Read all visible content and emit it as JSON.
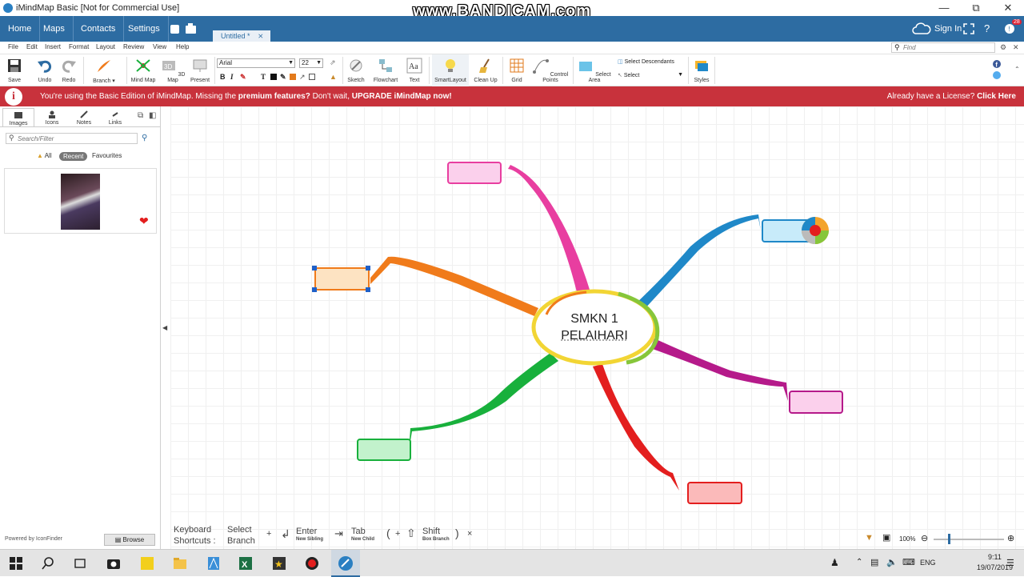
{
  "window": {
    "title": "iMindMap Basic [Not for Commercial Use]",
    "watermark": "www.BANDICAM.com"
  },
  "nav": {
    "home": "Home",
    "maps": "Maps",
    "contacts": "Contacts",
    "settings": "Settings",
    "sign_in": "Sign In",
    "notif_count": "28",
    "doc_tab": "Untitled *"
  },
  "menu": [
    "File",
    "Edit",
    "Insert",
    "Format",
    "Layout",
    "Review",
    "View",
    "Help"
  ],
  "find_placeholder": "Find",
  "ribbon": {
    "save": "Save",
    "undo": "Undo",
    "redo": "Redo",
    "branch": "Branch",
    "mindmap": "Mind Map",
    "map3d": "3D Map",
    "present": "Present",
    "font": "Arial",
    "size": "22",
    "sketch": "Sketch",
    "flowchart": "Flowchart",
    "text": "Text",
    "smartlayout": "SmartLayout",
    "cleanup": "Clean Up",
    "grid": "Grid",
    "controlpoints": "Control Points",
    "selectarea": "Select Area",
    "selectdesc": "Select Descendants",
    "select": "Select",
    "styles": "Styles"
  },
  "banner": {
    "pre": "You're using the Basic Edition of iMindMap. Missing the ",
    "bold1": "premium features?",
    "mid": " Don't wait, ",
    "bold2": "UPGRADE iMindMap now!",
    "right_pre": "Already have a License? ",
    "right_bold": "Click Here"
  },
  "panel": {
    "tabs": [
      "Images",
      "Icons",
      "Notes",
      "Links"
    ],
    "search_placeholder": "Search/Filter",
    "filters": {
      "all": "All",
      "recent": "Recent",
      "favourites": "Favourites"
    },
    "powered": "Powered by IconFinder",
    "browse": "Browse"
  },
  "central": {
    "line1": "SMKN 1",
    "line2": "PELAIHARI"
  },
  "shortcuts": {
    "kb1": "Keyboard",
    "kb2": "Shortcuts :",
    "sel1": "Select",
    "sel2": "Branch",
    "plus": "+",
    "enter": "Enter",
    "enter_sub": "New Sibling",
    "tab": "Tab",
    "tab_sub": "New Child",
    "shift": "Shift",
    "shift_sub": "Box Branch",
    "close": "×"
  },
  "zoom": "100%",
  "tray": {
    "lang": "ENG",
    "time": "9:11",
    "date": "19/07/2019"
  },
  "colors": {
    "nav_bg": "#2d6ca2",
    "banner_bg": "#c8323c",
    "orange": "#f07b1b",
    "pink": "#e83ea0",
    "blue": "#1f88c8",
    "magenta": "#b51a8a",
    "red": "#e31e1e",
    "green": "#18b03c"
  }
}
